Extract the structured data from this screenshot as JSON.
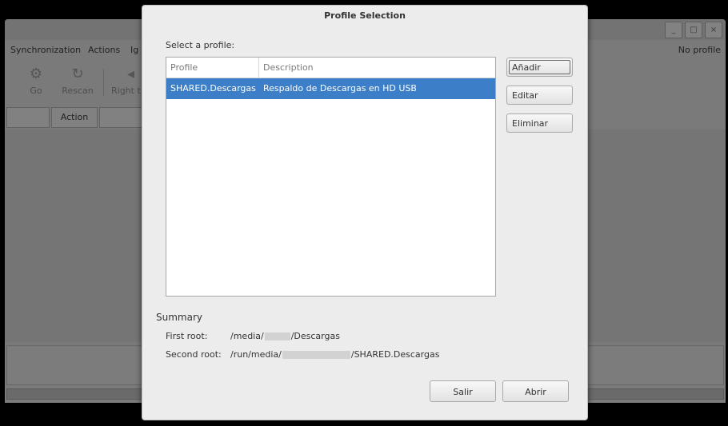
{
  "background_window": {
    "menu": [
      "Synchronization",
      "Actions",
      "Ig"
    ],
    "profile_status": "No profile",
    "window_buttons": {
      "minimize": "_",
      "maximize": "□",
      "close": "×"
    },
    "toolbar": [
      {
        "label": "Go",
        "icon": "gears-icon"
      },
      {
        "label": "Rescan",
        "icon": "refresh-icon"
      },
      {
        "label": "Right t",
        "icon": "arrow-icon"
      }
    ],
    "headers": {
      "action": "Action"
    }
  },
  "dialog": {
    "title": "Profile Selection",
    "select_label": "Select a profile:",
    "table": {
      "columns": [
        "Profile",
        "Description"
      ],
      "rows": [
        {
          "profile": "SHARED.Descargas",
          "description": "Respaldo de Descargas en HD USB",
          "selected": true
        }
      ]
    },
    "buttons": {
      "add": "Añadir",
      "edit": "Editar",
      "delete": "Eliminar",
      "quit": "Salir",
      "open": "Abrir"
    },
    "summary": {
      "heading": "Summary",
      "first_root_label": "First root:",
      "first_root_prefix": "/media/",
      "first_root_suffix": "/Descargas",
      "second_root_label": "Second root:",
      "second_root_prefix": "/run/media/",
      "second_root_suffix": "/SHARED.Descargas"
    }
  }
}
